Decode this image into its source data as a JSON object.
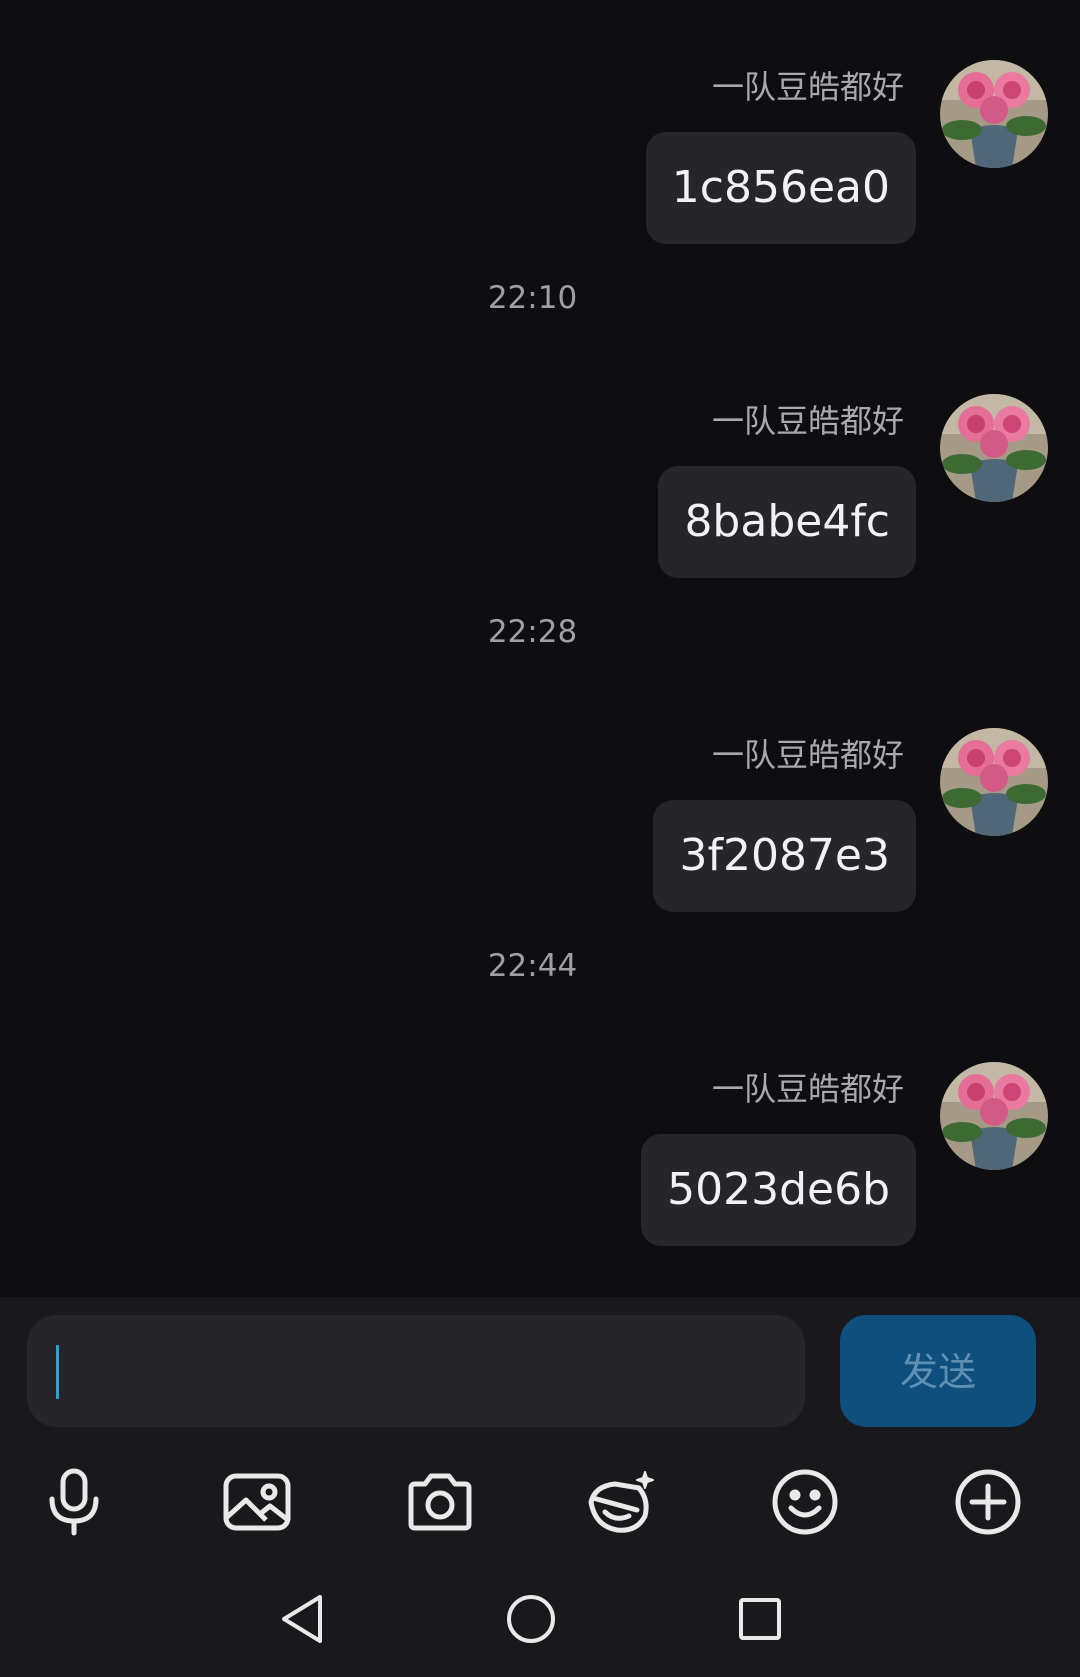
{
  "messages": [
    {
      "sender": "一队豆皓都好",
      "text": "1c856ea0"
    },
    {
      "sender": "一队豆皓都好",
      "text": "8babe4fc"
    },
    {
      "sender": "一队豆皓都好",
      "text": "3f2087e3"
    },
    {
      "sender": "一队豆皓都好",
      "text": "5023de6b"
    }
  ],
  "timestamps": [
    "22:10",
    "22:28",
    "22:44"
  ],
  "composer": {
    "input_value": "",
    "send_label": "发送"
  },
  "toolbar_icons": [
    "microphone-icon",
    "image-icon",
    "camera-icon",
    "sticker-icon",
    "emoji-icon",
    "plus-circle-icon"
  ],
  "nav_icons": [
    "back-icon",
    "home-icon",
    "recents-icon"
  ],
  "colors": {
    "background": "#0e0e11",
    "bubble": "#262629",
    "send_button": "#0e4f7e",
    "caret": "#2aa4d8"
  }
}
